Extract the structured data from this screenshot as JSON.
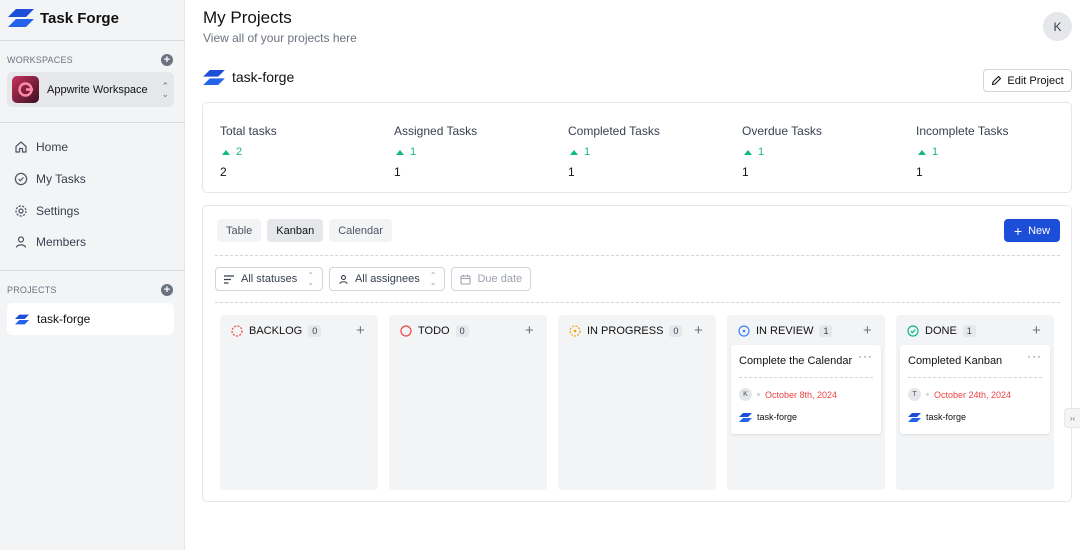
{
  "app": {
    "name": "Task Forge"
  },
  "sidebar": {
    "workspaces_label": "WORKSPACES",
    "workspace_name": "Appwrite Workspace",
    "nav": [
      {
        "label": "Home",
        "icon": "home-icon"
      },
      {
        "label": "My Tasks",
        "icon": "check-circle-icon"
      },
      {
        "label": "Settings",
        "icon": "gear-icon"
      },
      {
        "label": "Members",
        "icon": "user-icon"
      }
    ],
    "projects_label": "PROJECTS",
    "projects": [
      {
        "label": "task-forge"
      }
    ]
  },
  "header": {
    "title": "My Projects",
    "subtitle": "View all of your projects here",
    "avatar_initial": "K"
  },
  "project": {
    "name": "task-forge",
    "edit_label": "Edit Project"
  },
  "stats": [
    {
      "label": "Total tasks",
      "trend": "2",
      "value": "2"
    },
    {
      "label": "Assigned Tasks",
      "trend": "1",
      "value": "1"
    },
    {
      "label": "Completed Tasks",
      "trend": "1",
      "value": "1"
    },
    {
      "label": "Overdue Tasks",
      "trend": "1",
      "value": "1"
    },
    {
      "label": "Incomplete Tasks",
      "trend": "1",
      "value": "1"
    }
  ],
  "views": {
    "tabs": [
      "Table",
      "Kanban",
      "Calendar"
    ],
    "active": "Kanban",
    "new_label": "New"
  },
  "filters": {
    "status": "All statuses",
    "assignee": "All assignees",
    "due": "Due date"
  },
  "columns": [
    {
      "title": "BACKLOG",
      "count": "0",
      "color": "#ef4444"
    },
    {
      "title": "TODO",
      "count": "0",
      "color": "#ef4444"
    },
    {
      "title": "IN PROGRESS",
      "count": "0",
      "color": "#f59e0b"
    },
    {
      "title": "IN REVIEW",
      "count": "1",
      "color": "#3b82f6",
      "card": {
        "title": "Complete the Calendar",
        "assignee": "K",
        "due": "October 8th, 2024",
        "project": "task-forge"
      }
    },
    {
      "title": "DONE",
      "count": "1",
      "color": "#10b981",
      "card": {
        "title": "Completed Kanban",
        "assignee": "T",
        "due": "October 24th, 2024",
        "project": "task-forge"
      }
    }
  ],
  "colors": {
    "accent": "#1d4ed8",
    "positive": "#10b981",
    "due": "#ef4444"
  }
}
